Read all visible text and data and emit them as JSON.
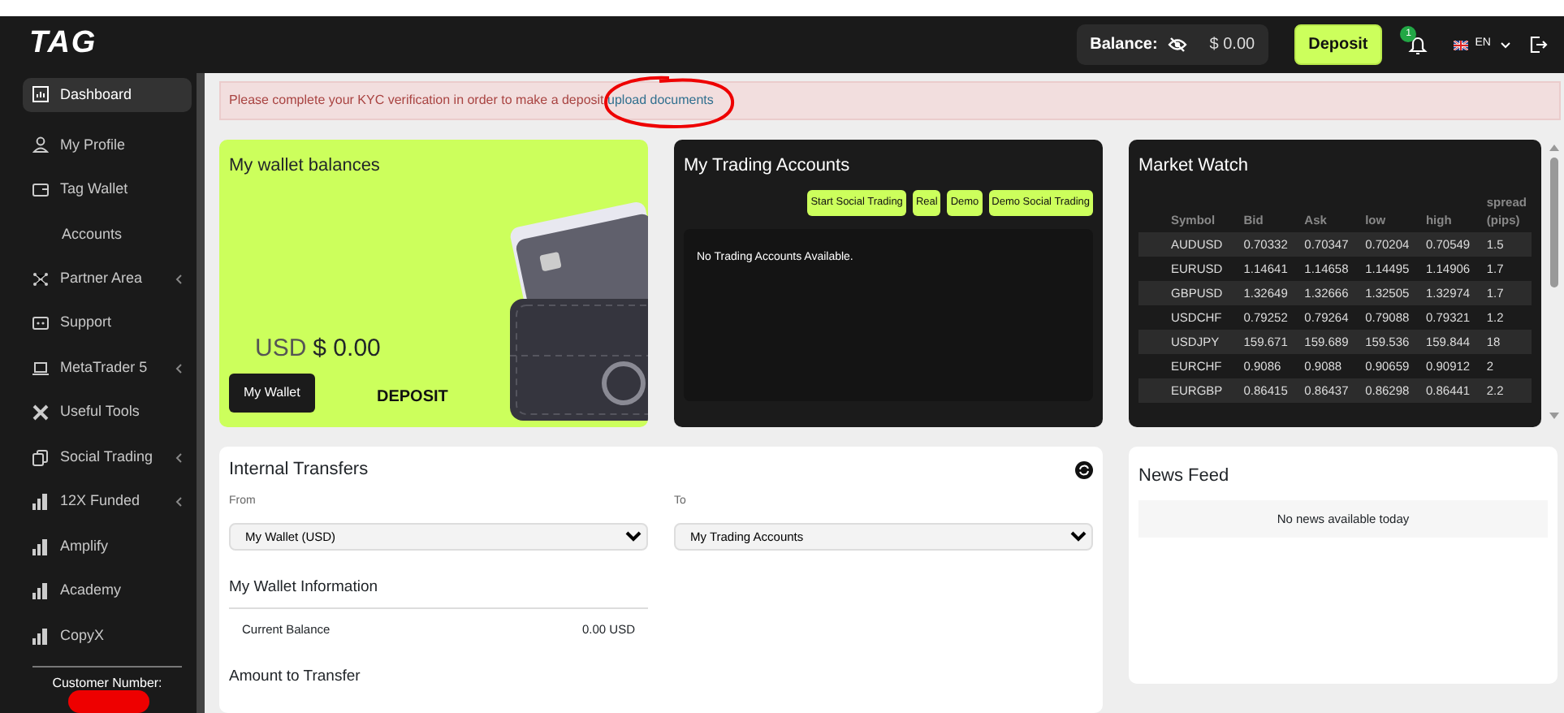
{
  "header": {
    "logo": "TAG",
    "balance_label": "Balance:",
    "balance_value": "$ 0.00",
    "deposit_button": "Deposit",
    "notification_count": "1",
    "language": "EN"
  },
  "sidebar": {
    "items": [
      {
        "label": "Dashboard",
        "selected": true,
        "has_submenu": false
      },
      {
        "label": "My Profile",
        "selected": false,
        "has_submenu": false
      },
      {
        "label": "Tag Wallet",
        "selected": false,
        "has_submenu": false,
        "children": [
          {
            "label": "Accounts",
            "selected": false
          }
        ]
      },
      {
        "label": "Partner Area",
        "selected": false,
        "has_submenu": true
      },
      {
        "label": "Support",
        "selected": false,
        "has_submenu": false
      },
      {
        "label": "MetaTrader 5",
        "selected": false,
        "has_submenu": true
      },
      {
        "label": "Useful Tools",
        "selected": false,
        "has_submenu": false
      },
      {
        "label": "Social Trading",
        "selected": false,
        "has_submenu": true
      },
      {
        "label": "12X Funded",
        "selected": false,
        "has_submenu": true
      },
      {
        "label": "Amplify",
        "selected": false,
        "has_submenu": false
      },
      {
        "label": "Academy",
        "selected": false,
        "has_submenu": false
      },
      {
        "label": "CopyX",
        "selected": false,
        "has_submenu": false
      }
    ],
    "customer_number_label": "Customer Number:"
  },
  "alert": {
    "message": "Please complete your KYC verification in order to make a deposit",
    "link": "upload documents"
  },
  "wallet_card": {
    "title": "My wallet balances",
    "currency": "USD",
    "amount": "$ 0.00",
    "wallet_button": "My Wallet",
    "deposit_link": "DEPOSIT"
  },
  "trading_accounts": {
    "title": "My Trading Accounts",
    "filters": [
      "Start Social Trading",
      "Real",
      "Demo",
      "Demo Social Trading"
    ],
    "empty_message": "No Trading Accounts Available."
  },
  "market_watch": {
    "title": "Market Watch",
    "columns": [
      "Symbol",
      "Bid",
      "Ask",
      "low",
      "high",
      "spread (pips)"
    ],
    "rows": [
      [
        "AUDUSD",
        "0.70332",
        "0.70347",
        "0.70204",
        "0.70549",
        "1.5"
      ],
      [
        "EURUSD",
        "1.14641",
        "1.14658",
        "1.14495",
        "1.14906",
        "1.7"
      ],
      [
        "GBPUSD",
        "1.32649",
        "1.32666",
        "1.32505",
        "1.32974",
        "1.7"
      ],
      [
        "USDCHF",
        "0.79252",
        "0.79264",
        "0.79088",
        "0.79321",
        "1.2"
      ],
      [
        "USDJPY",
        "159.671",
        "159.689",
        "159.536",
        "159.844",
        "18"
      ],
      [
        "EURCHF",
        "0.9086",
        "0.9088",
        "0.90659",
        "0.90912",
        "2"
      ],
      [
        "EURGBP",
        "0.86415",
        "0.86437",
        "0.86298",
        "0.86441",
        "2.2"
      ]
    ]
  },
  "internal_transfers": {
    "title": "Internal Transfers",
    "from": {
      "label": "From",
      "value": "My Wallet (USD)"
    },
    "to": {
      "label": "To",
      "value": "My Trading Accounts"
    },
    "wallet_info_title": "My Wallet Information",
    "balance_label": "Current Balance",
    "balance_value": "0.00 USD",
    "amount_title": "Amount to Transfer"
  },
  "news_feed": {
    "title": "News Feed",
    "empty_message": "No news available today"
  }
}
